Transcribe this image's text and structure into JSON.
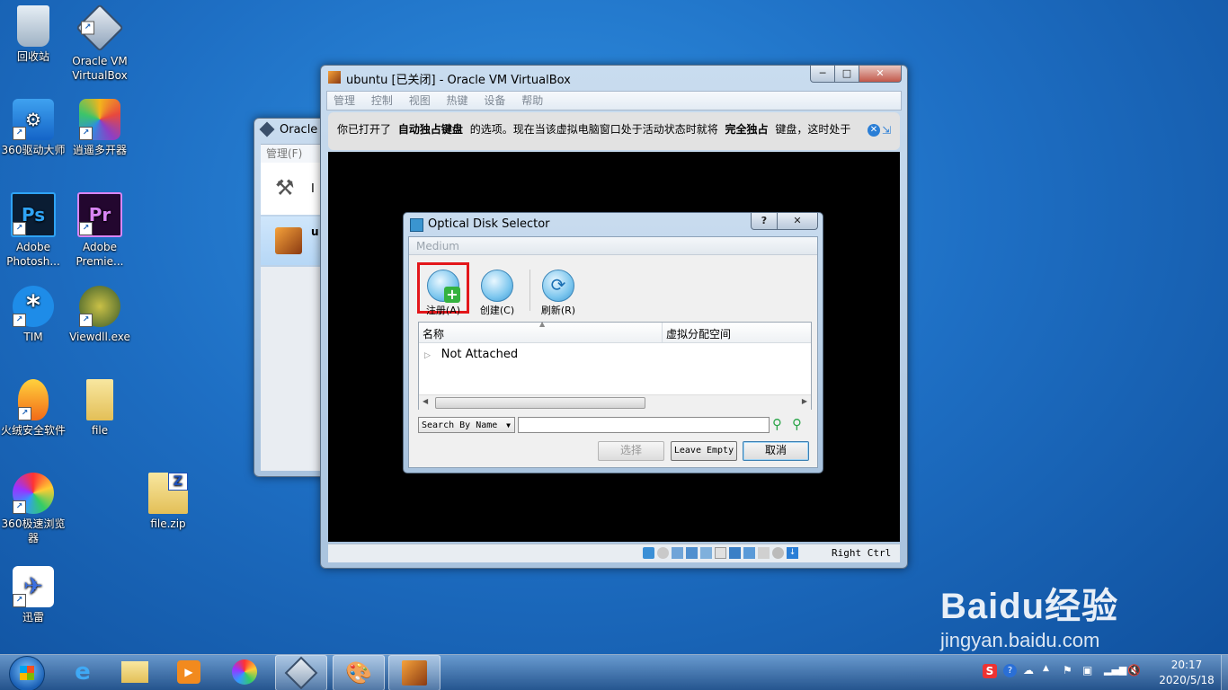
{
  "desktop_icons": [
    {
      "label": "回收站"
    },
    {
      "label": "Oracle VM VirtualBox"
    },
    {
      "label": "360驱动大师"
    },
    {
      "label": "逍遥多开器"
    },
    {
      "label": "Adobe Photosh..."
    },
    {
      "label": "Adobe Premie..."
    },
    {
      "label": "TIM"
    },
    {
      "label": "Viewdll.exe"
    },
    {
      "label": "火绒安全软件"
    },
    {
      "label": "file"
    },
    {
      "label": "360极速浏览器"
    },
    {
      "label": "file.zip"
    },
    {
      "label": "迅雷"
    }
  ],
  "bg_window": {
    "title": "Oracle V",
    "menu_first": "管理(F)",
    "row1_text": "I",
    "row2_text": "u"
  },
  "vm_window": {
    "title": "ubuntu [已关闭] - Oracle VM VirtualBox",
    "menu": [
      "管理",
      "控制",
      "视图",
      "热键",
      "设备",
      "帮助"
    ],
    "notice_part1": "你已打开了",
    "notice_bold1": "自动独占键盘",
    "notice_part2": "的选项。现在当该虚拟电脑窗口处于活动状态时就将",
    "notice_bold2": "完全独占",
    "notice_part3": "键盘，这时处于",
    "status_hostkey": "Right Ctrl"
  },
  "dialog": {
    "title": "Optical Disk Selector",
    "help_label": "?",
    "close_label": "✕",
    "tab_label": "Medium",
    "toolbar": {
      "register_label": "注册(A)",
      "create_label": "创建(C)",
      "refresh_label": "刷新(R)"
    },
    "columns": [
      "名称",
      "虚拟分配空间"
    ],
    "tree_item": "Not Attached",
    "search_mode": "Search By Name",
    "search_value": "",
    "choose_label": "选择",
    "leave_empty_label": "Leave Empty",
    "cancel_label": "取消"
  },
  "taskbar": {
    "time": "20:17",
    "date": "2020/5/18"
  },
  "watermark": {
    "brand": "Baidu经验",
    "url": "jingyan.baidu.com"
  },
  "colors": {
    "highlight_box": "#e3171b",
    "desktop_bg": "#1e6fc4",
    "dialog_accent": "#3a95d0"
  }
}
